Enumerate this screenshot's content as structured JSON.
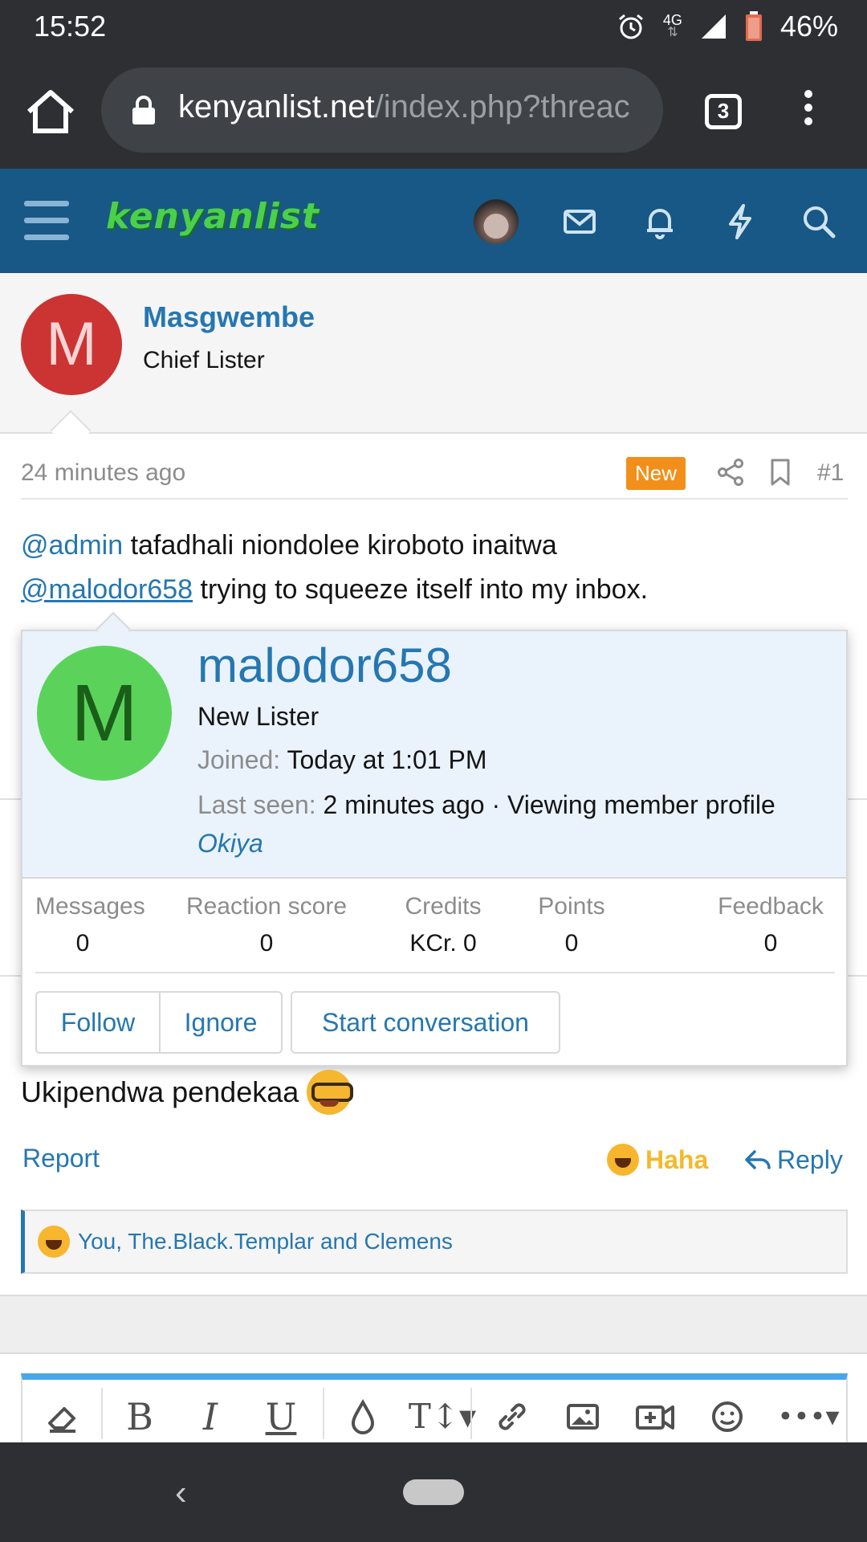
{
  "status_bar": {
    "time": "15:52",
    "network": "4G",
    "battery": "46%"
  },
  "browser": {
    "url_domain": "kenyanlist.net",
    "url_path": "/index.php?threac",
    "tab_count": "3"
  },
  "site": {
    "logo_text": "kenyanlist",
    "icons": [
      "menu-icon",
      "mail-icon",
      "bell-icon",
      "lightning-icon",
      "search-icon"
    ]
  },
  "poster": {
    "initial": "M",
    "name": "Masgwembe",
    "title": "Chief Lister"
  },
  "post": {
    "time_ago": "24 minutes ago",
    "badge": "New",
    "number": "#1",
    "mention1": "@admin",
    "text1": " tafadhali niondolee kiroboto inaitwa",
    "mention2": "@malodor658",
    "text2": " trying to squeeze itself into my inbox."
  },
  "popup": {
    "initial": "M",
    "name": "malodor658",
    "title": "New Lister",
    "joined_label": "Joined:",
    "joined_value": "Today at 1:01 PM",
    "seen_label": "Last seen:",
    "seen_value": "2 minutes ago · Viewing member profile",
    "seen_link": "Okiya",
    "stats": [
      {
        "label": "Messages",
        "value": "0"
      },
      {
        "label": "Reaction score",
        "value": "0"
      },
      {
        "label": "Credits",
        "value": "KCr. 0"
      },
      {
        "label": "Points",
        "value": "0"
      },
      {
        "label": "Feedback",
        "value": "0"
      }
    ],
    "follow_label": "Follow",
    "ignore_label": "Ignore",
    "conversation_label": "Start conversation"
  },
  "post2": {
    "text": "Ukipendwa pendekaa"
  },
  "post_footer": {
    "report": "Report",
    "reaction": "Haha",
    "reply": "Reply"
  },
  "reactions": {
    "text": "You, The.Black.Templar and Clemens"
  },
  "colors": {
    "brand": "#185886",
    "link": "#2577b1",
    "badge": "#f28f1a",
    "avatar_red": "#cc3333",
    "avatar_green": "#5bd35b"
  }
}
